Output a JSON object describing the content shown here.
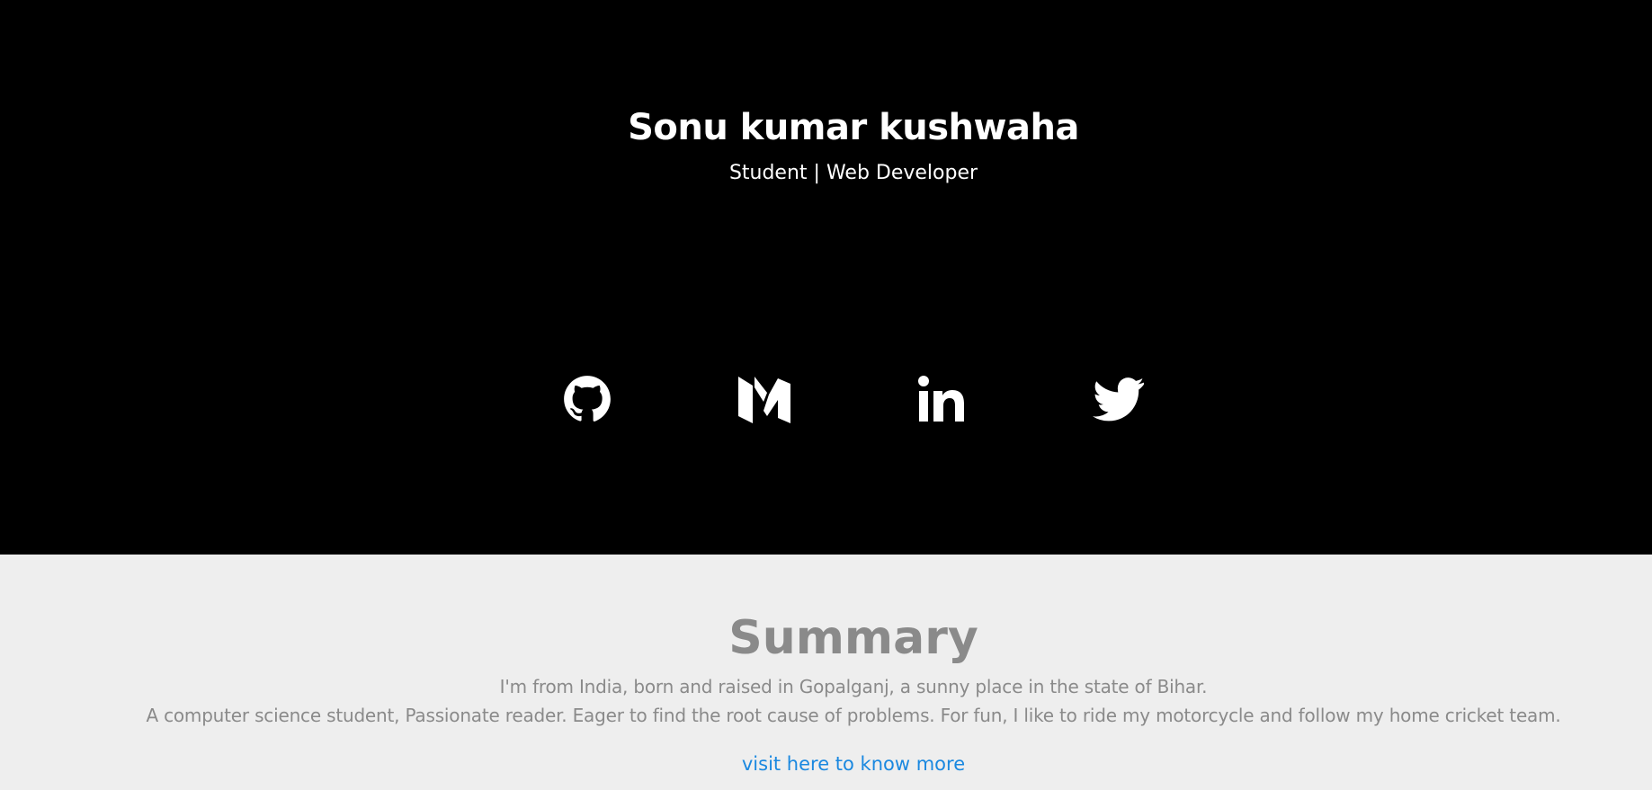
{
  "hero": {
    "name": "Sonu kumar kushwaha",
    "role": "Student | Web Developer"
  },
  "social": [
    {
      "name": "github",
      "icon": "github-icon"
    },
    {
      "name": "medium",
      "icon": "medium-icon"
    },
    {
      "name": "linkedin",
      "icon": "linkedin-icon"
    },
    {
      "name": "twitter",
      "icon": "twitter-icon"
    }
  ],
  "summary": {
    "title": "Summary",
    "line1": "I'm from India, born and raised in Gopalganj, a sunny place in the state of Bihar.",
    "line2": "A computer science student, Passionate reader. Eager to find the root cause of problems. For fun, I like to ride my motorcycle and follow my home cricket team.",
    "link_label": "visit here to know more"
  },
  "colors": {
    "hero_bg": "#000000",
    "hero_text": "#ffffff",
    "summary_bg": "#eeeeee",
    "summary_text": "#8a8a8a",
    "link": "#1a88e0"
  }
}
